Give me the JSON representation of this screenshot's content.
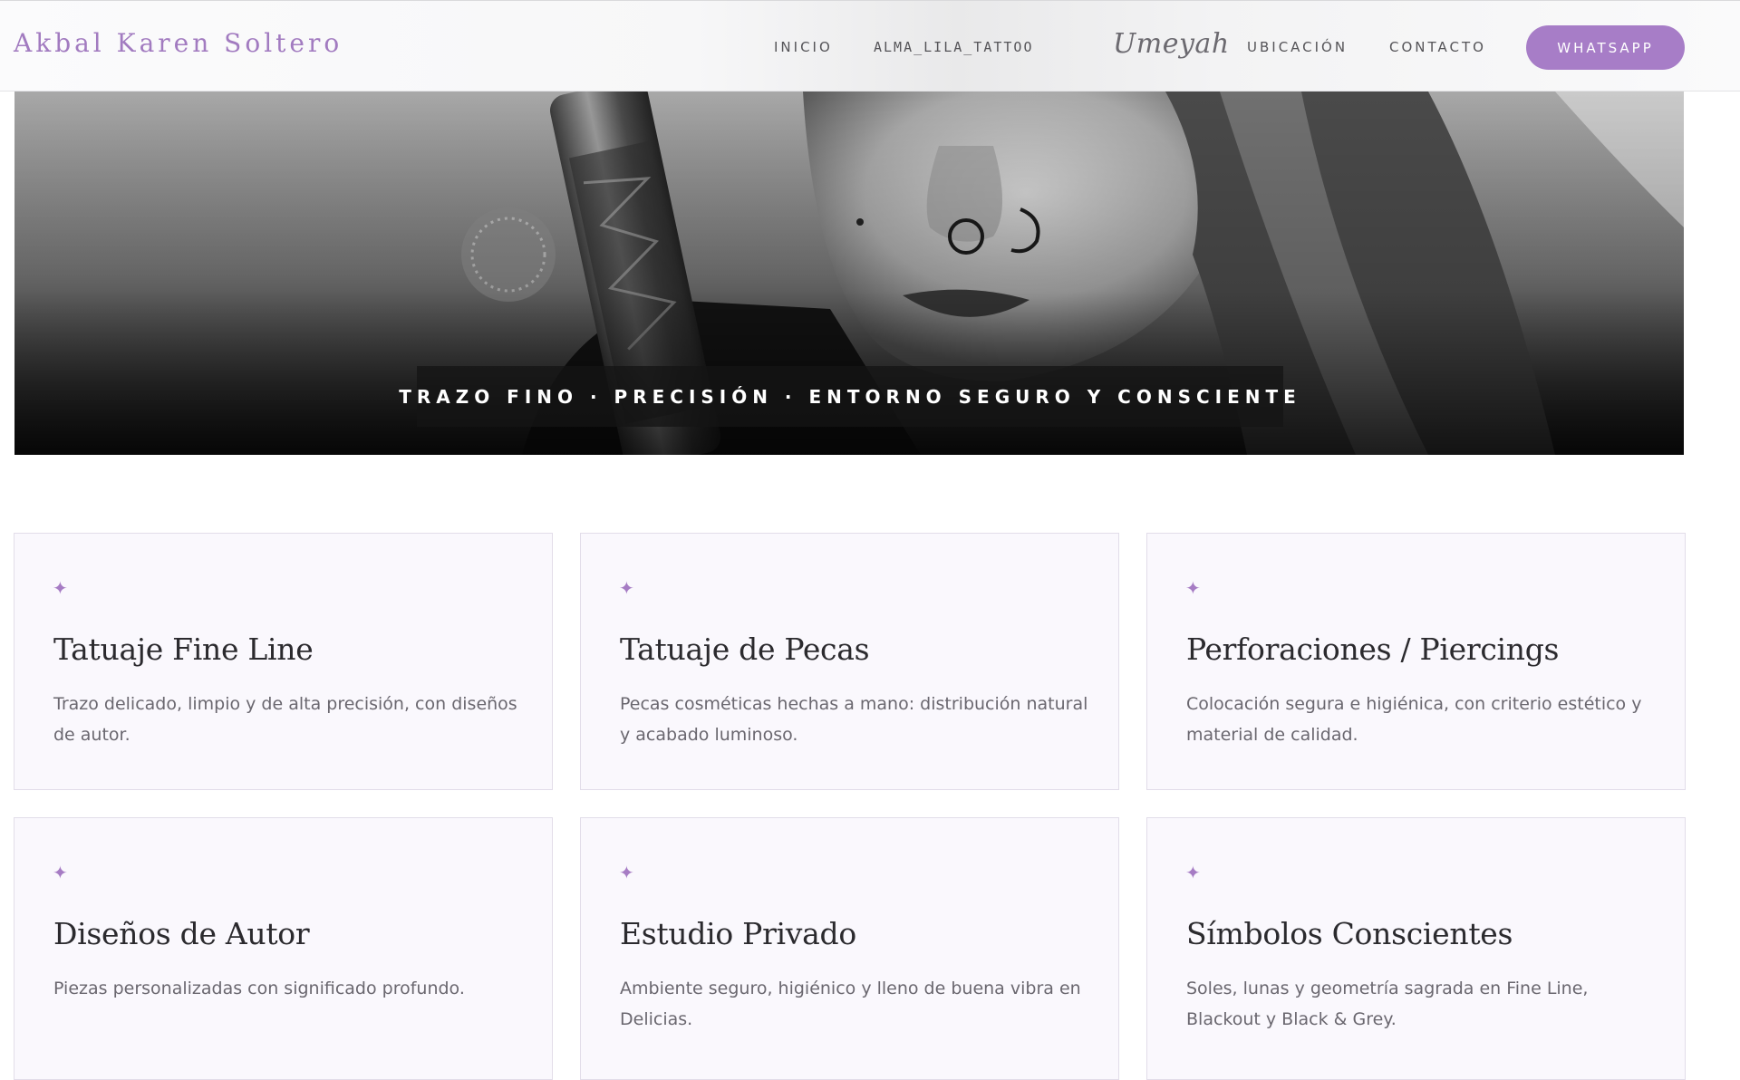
{
  "header": {
    "brand": "Akbal Karen Soltero",
    "nav": {
      "inicio": "INICIO",
      "alma": "ALMA_LILA_TATTOO",
      "umeyah": "Umeyah",
      "ubicacion": "UBICACIÓN",
      "contacto": "CONTACTO",
      "whatsapp": "WHATSAPP"
    }
  },
  "hero": {
    "caption": "TRAZO FINO · PRECISIÓN · ENTORNO SEGURO Y CONSCIENTE"
  },
  "cards": [
    {
      "icon": "sparkle-icon",
      "title": "Tatuaje Fine Line",
      "desc": "Trazo delicado, limpio y de alta precisión, con diseños de autor."
    },
    {
      "icon": "sparkle-icon",
      "title": "Tatuaje de Pecas",
      "desc": "Pecas cosméticas hechas a mano: distribución natural y acabado luminoso."
    },
    {
      "icon": "sparkle-icon",
      "title": "Perforaciones / Piercings",
      "desc": "Colocación segura e higiénica, con criterio estético y material de calidad."
    },
    {
      "icon": "sparkle-icon",
      "title": "Diseños de Autor",
      "desc": "Piezas personalizadas con significado profundo."
    },
    {
      "icon": "sparkle-icon",
      "title": "Estudio Privado",
      "desc": "Ambiente seguro, higiénico y lleno de buena vibra en Delicias."
    },
    {
      "icon": "sparkle-icon",
      "title": "Símbolos Conscientes",
      "desc": "Soles, lunas y geometría sagrada en Fine Line, Blackout y Black & Grey."
    }
  ],
  "colors": {
    "accent": "#a77dc7",
    "card_bg": "#faf8fd"
  }
}
